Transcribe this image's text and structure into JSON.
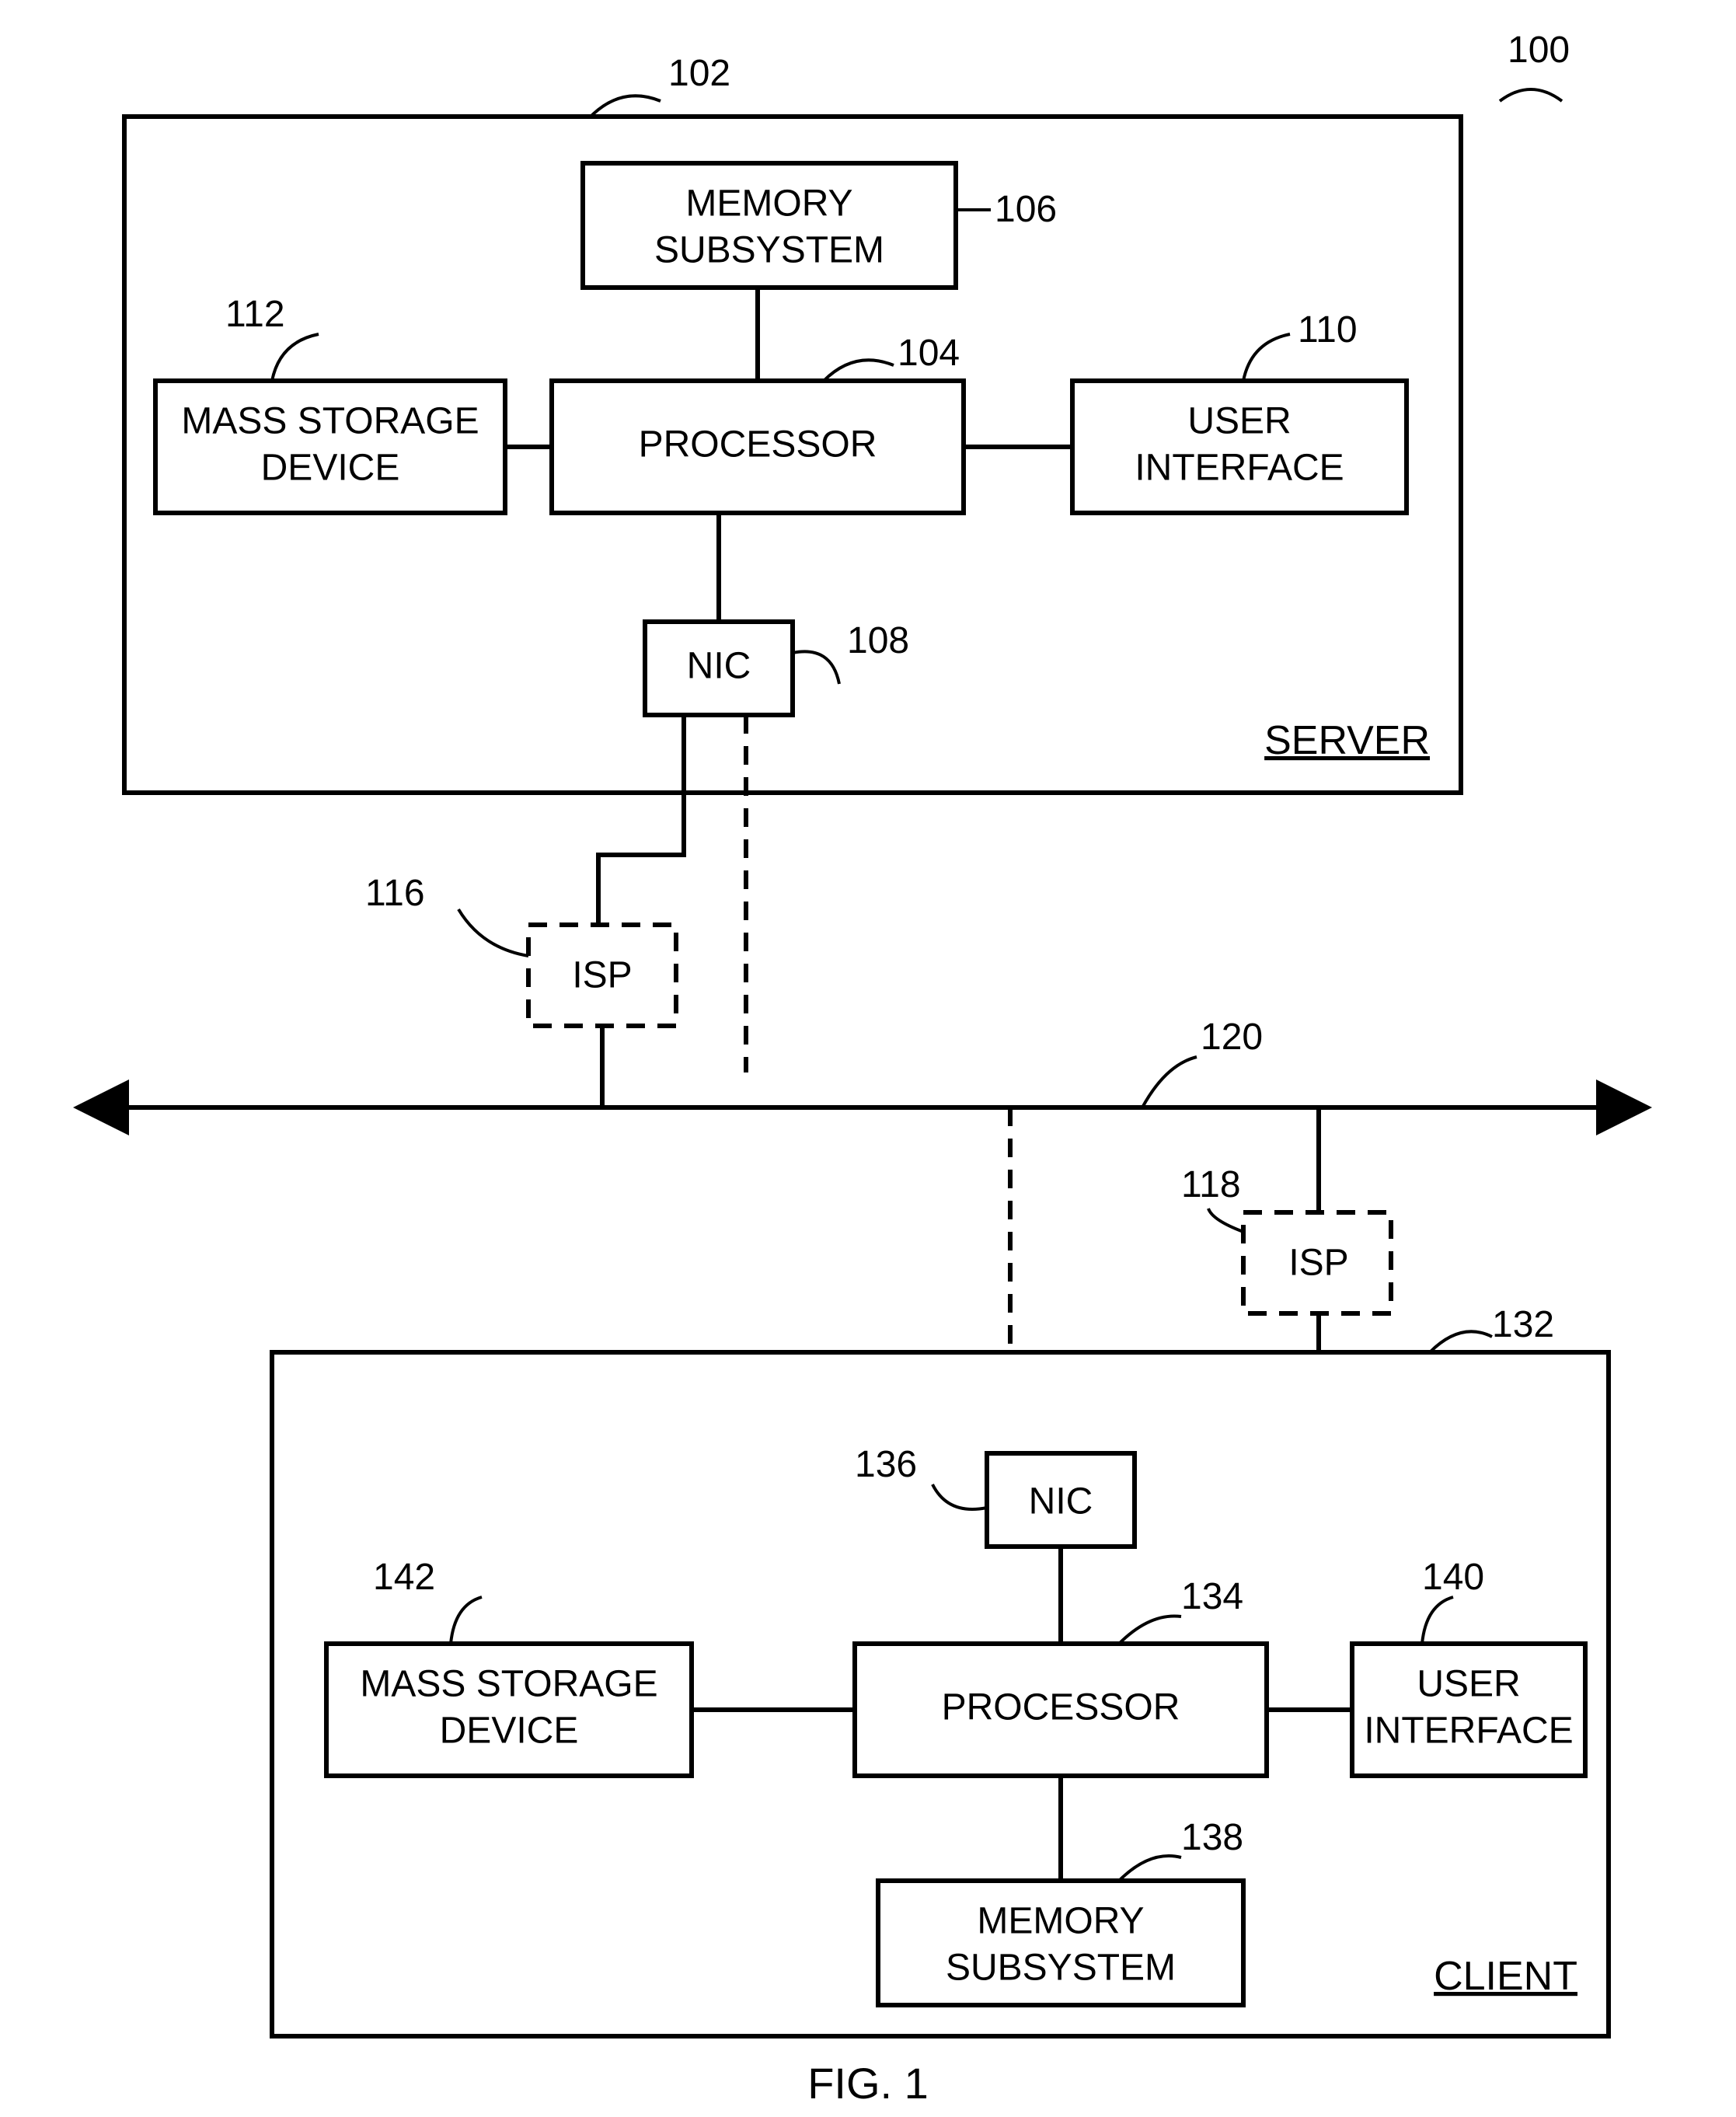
{
  "figure_caption": "FIG. 1",
  "diagram_ref": "100",
  "server": {
    "container_ref": "102",
    "title": "SERVER",
    "processor": {
      "label": "PROCESSOR",
      "ref": "104"
    },
    "memory": {
      "label1": "MEMORY",
      "label2": "SUBSYSTEM",
      "ref": "106"
    },
    "nic": {
      "label": "NIC",
      "ref": "108"
    },
    "ui": {
      "label1": "USER",
      "label2": "INTERFACE",
      "ref": "110"
    },
    "storage": {
      "label1": "MASS STORAGE",
      "label2": "DEVICE",
      "ref": "112"
    }
  },
  "isp1": {
    "label": "ISP",
    "ref": "116"
  },
  "isp2": {
    "label": "ISP",
    "ref": "118"
  },
  "bus_ref": "120",
  "client": {
    "container_ref": "132",
    "title": "CLIENT",
    "processor": {
      "label": "PROCESSOR",
      "ref": "134"
    },
    "nic": {
      "label": "NIC",
      "ref": "136"
    },
    "memory": {
      "label1": "MEMORY",
      "label2": "SUBSYSTEM",
      "ref": "138"
    },
    "ui": {
      "label1": "USER",
      "label2": "INTERFACE",
      "ref": "140"
    },
    "storage": {
      "label1": "MASS STORAGE",
      "label2": "DEVICE",
      "ref": "142"
    }
  }
}
